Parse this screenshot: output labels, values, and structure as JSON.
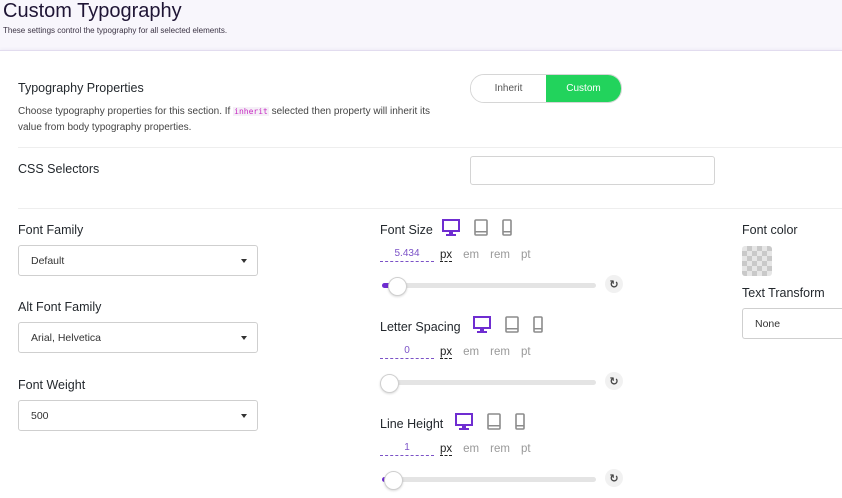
{
  "header": {
    "title": "Custom Typography",
    "subtitle": "These settings control the typography for all selected elements."
  },
  "typography_properties": {
    "label": "Typography Properties",
    "description_before": "Choose typography properties for this section. If ",
    "description_code": "inherit",
    "description_after": " selected then property will inherit its value from body typography properties.",
    "toggle": {
      "inherit_label": "Inherit",
      "custom_label": "Custom",
      "selected": "Custom"
    }
  },
  "css_selectors": {
    "label": "CSS Selectors",
    "value": ""
  },
  "font_family": {
    "label": "Font Family",
    "value": "Default"
  },
  "alt_font_family": {
    "label": "Alt Font Family",
    "value": "Arial, Helvetica"
  },
  "font_weight": {
    "label": "Font Weight",
    "value": "500"
  },
  "font_size": {
    "label": "Font Size",
    "value": "5.434",
    "units": [
      "px",
      "em",
      "rem",
      "pt"
    ],
    "active_unit": "px",
    "slider_fraction": 0.04
  },
  "letter_spacing": {
    "label": "Letter Spacing",
    "value": "0",
    "units": [
      "px",
      "em",
      "rem",
      "pt"
    ],
    "active_unit": "px",
    "slider_fraction": 0.0
  },
  "line_height": {
    "label": "Line Height",
    "value": "1",
    "units": [
      "px",
      "em",
      "rem",
      "pt"
    ],
    "active_unit": "px",
    "slider_fraction": 0.02
  },
  "font_color": {
    "label": "Font color",
    "value": "transparent"
  },
  "text_transform": {
    "label": "Text Transform",
    "value": "None"
  },
  "icons": {
    "desktop": "desktop-icon",
    "tablet": "tablet-icon",
    "mobile": "mobile-icon",
    "reset": "reset-icon",
    "dropdown": "chevron-down-icon"
  },
  "colors": {
    "accent_purple": "#6f2dd1",
    "toggle_green": "#22d35c",
    "inactive_device": "#8c8c8c"
  }
}
